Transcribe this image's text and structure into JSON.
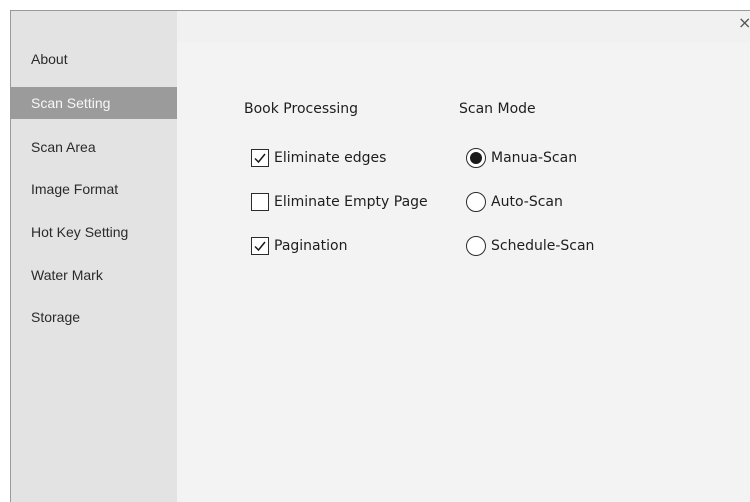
{
  "window": {
    "close_glyph": "×"
  },
  "sidebar": {
    "items": [
      {
        "label": "About",
        "selected": false
      },
      {
        "label": "Scan Setting",
        "selected": true
      },
      {
        "label": "Scan Area",
        "selected": false
      },
      {
        "label": "Image Format",
        "selected": false
      },
      {
        "label": "Hot Key Setting",
        "selected": false
      },
      {
        "label": "Water Mark",
        "selected": false
      },
      {
        "label": "Storage",
        "selected": false
      }
    ]
  },
  "book_processing": {
    "title": "Book Processing",
    "options": [
      {
        "label": "Eliminate edges",
        "checked": true
      },
      {
        "label": "Eliminate Empty Page",
        "checked": false
      },
      {
        "label": "Pagination",
        "checked": true
      }
    ]
  },
  "scan_mode": {
    "title": "Scan Mode",
    "options": [
      {
        "label": "Manua-Scan",
        "selected": true
      },
      {
        "label": "Auto-Scan",
        "selected": false
      },
      {
        "label": "Schedule-Scan",
        "selected": false
      }
    ]
  },
  "colors": {
    "sidebar_bg": "#e3e3e3",
    "sidebar_selected_bg": "#9b9b9b",
    "content_bg": "#f3f3f3"
  }
}
